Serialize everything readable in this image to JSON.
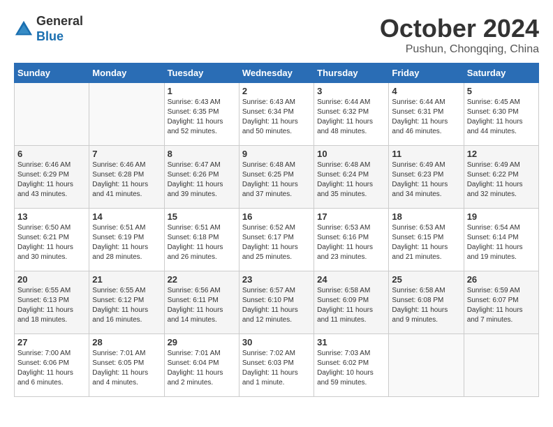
{
  "header": {
    "logo_general": "General",
    "logo_blue": "Blue",
    "month_title": "October 2024",
    "subtitle": "Pushun, Chongqing, China"
  },
  "days_of_week": [
    "Sunday",
    "Monday",
    "Tuesday",
    "Wednesday",
    "Thursday",
    "Friday",
    "Saturday"
  ],
  "weeks": [
    [
      {
        "day": "",
        "info": ""
      },
      {
        "day": "",
        "info": ""
      },
      {
        "day": "1",
        "info": "Sunrise: 6:43 AM\nSunset: 6:35 PM\nDaylight: 11 hours and 52 minutes."
      },
      {
        "day": "2",
        "info": "Sunrise: 6:43 AM\nSunset: 6:34 PM\nDaylight: 11 hours and 50 minutes."
      },
      {
        "day": "3",
        "info": "Sunrise: 6:44 AM\nSunset: 6:32 PM\nDaylight: 11 hours and 48 minutes."
      },
      {
        "day": "4",
        "info": "Sunrise: 6:44 AM\nSunset: 6:31 PM\nDaylight: 11 hours and 46 minutes."
      },
      {
        "day": "5",
        "info": "Sunrise: 6:45 AM\nSunset: 6:30 PM\nDaylight: 11 hours and 44 minutes."
      }
    ],
    [
      {
        "day": "6",
        "info": "Sunrise: 6:46 AM\nSunset: 6:29 PM\nDaylight: 11 hours and 43 minutes."
      },
      {
        "day": "7",
        "info": "Sunrise: 6:46 AM\nSunset: 6:28 PM\nDaylight: 11 hours and 41 minutes."
      },
      {
        "day": "8",
        "info": "Sunrise: 6:47 AM\nSunset: 6:26 PM\nDaylight: 11 hours and 39 minutes."
      },
      {
        "day": "9",
        "info": "Sunrise: 6:48 AM\nSunset: 6:25 PM\nDaylight: 11 hours and 37 minutes."
      },
      {
        "day": "10",
        "info": "Sunrise: 6:48 AM\nSunset: 6:24 PM\nDaylight: 11 hours and 35 minutes."
      },
      {
        "day": "11",
        "info": "Sunrise: 6:49 AM\nSunset: 6:23 PM\nDaylight: 11 hours and 34 minutes."
      },
      {
        "day": "12",
        "info": "Sunrise: 6:49 AM\nSunset: 6:22 PM\nDaylight: 11 hours and 32 minutes."
      }
    ],
    [
      {
        "day": "13",
        "info": "Sunrise: 6:50 AM\nSunset: 6:21 PM\nDaylight: 11 hours and 30 minutes."
      },
      {
        "day": "14",
        "info": "Sunrise: 6:51 AM\nSunset: 6:19 PM\nDaylight: 11 hours and 28 minutes."
      },
      {
        "day": "15",
        "info": "Sunrise: 6:51 AM\nSunset: 6:18 PM\nDaylight: 11 hours and 26 minutes."
      },
      {
        "day": "16",
        "info": "Sunrise: 6:52 AM\nSunset: 6:17 PM\nDaylight: 11 hours and 25 minutes."
      },
      {
        "day": "17",
        "info": "Sunrise: 6:53 AM\nSunset: 6:16 PM\nDaylight: 11 hours and 23 minutes."
      },
      {
        "day": "18",
        "info": "Sunrise: 6:53 AM\nSunset: 6:15 PM\nDaylight: 11 hours and 21 minutes."
      },
      {
        "day": "19",
        "info": "Sunrise: 6:54 AM\nSunset: 6:14 PM\nDaylight: 11 hours and 19 minutes."
      }
    ],
    [
      {
        "day": "20",
        "info": "Sunrise: 6:55 AM\nSunset: 6:13 PM\nDaylight: 11 hours and 18 minutes."
      },
      {
        "day": "21",
        "info": "Sunrise: 6:55 AM\nSunset: 6:12 PM\nDaylight: 11 hours and 16 minutes."
      },
      {
        "day": "22",
        "info": "Sunrise: 6:56 AM\nSunset: 6:11 PM\nDaylight: 11 hours and 14 minutes."
      },
      {
        "day": "23",
        "info": "Sunrise: 6:57 AM\nSunset: 6:10 PM\nDaylight: 11 hours and 12 minutes."
      },
      {
        "day": "24",
        "info": "Sunrise: 6:58 AM\nSunset: 6:09 PM\nDaylight: 11 hours and 11 minutes."
      },
      {
        "day": "25",
        "info": "Sunrise: 6:58 AM\nSunset: 6:08 PM\nDaylight: 11 hours and 9 minutes."
      },
      {
        "day": "26",
        "info": "Sunrise: 6:59 AM\nSunset: 6:07 PM\nDaylight: 11 hours and 7 minutes."
      }
    ],
    [
      {
        "day": "27",
        "info": "Sunrise: 7:00 AM\nSunset: 6:06 PM\nDaylight: 11 hours and 6 minutes."
      },
      {
        "day": "28",
        "info": "Sunrise: 7:01 AM\nSunset: 6:05 PM\nDaylight: 11 hours and 4 minutes."
      },
      {
        "day": "29",
        "info": "Sunrise: 7:01 AM\nSunset: 6:04 PM\nDaylight: 11 hours and 2 minutes."
      },
      {
        "day": "30",
        "info": "Sunrise: 7:02 AM\nSunset: 6:03 PM\nDaylight: 11 hours and 1 minute."
      },
      {
        "day": "31",
        "info": "Sunrise: 7:03 AM\nSunset: 6:02 PM\nDaylight: 10 hours and 59 minutes."
      },
      {
        "day": "",
        "info": ""
      },
      {
        "day": "",
        "info": ""
      }
    ]
  ]
}
